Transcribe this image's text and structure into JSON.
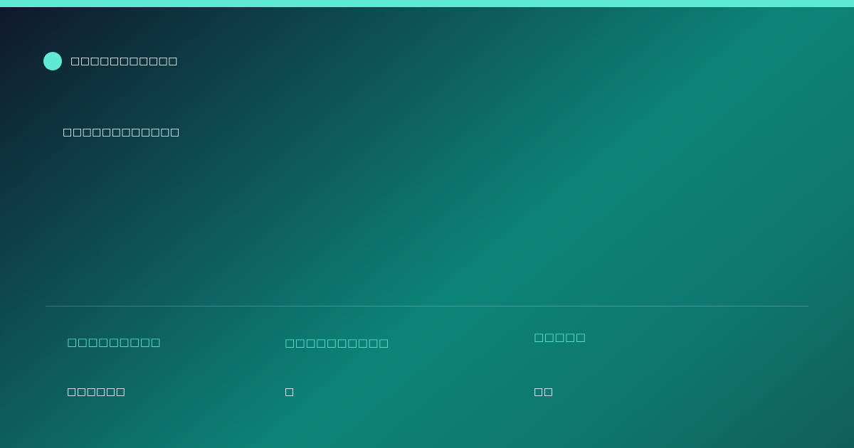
{
  "brand": {
    "name": "□□□□□□□□□□□",
    "accent": "#5eead4"
  },
  "headline": "□□□□□□□□□□□□",
  "stats": [
    {
      "label": "□□□□□□□□□",
      "value": "□□□□□□"
    },
    {
      "label": "□□□□□□□□□□",
      "value": "□"
    },
    {
      "label": "□□□□□",
      "value": "□□"
    }
  ],
  "colors": {
    "accent": "#5eead4",
    "gradient_start": "#0f172a",
    "gradient_mid": "#0d8479",
    "gradient_end": "#115e59"
  }
}
